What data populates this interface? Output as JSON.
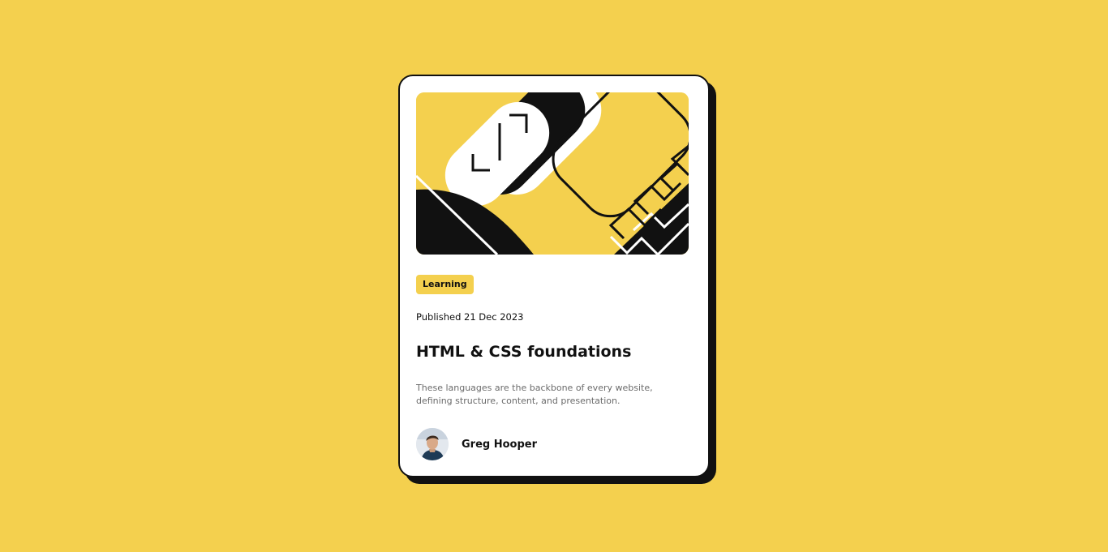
{
  "card": {
    "tag": "Learning",
    "published": "Published 21 Dec 2023",
    "title": "HTML & CSS foundations",
    "excerpt": "These languages are the backbone of every website, defining structure, content, and presentation.",
    "author": {
      "name": "Greg Hooper",
      "avatar_icon": "avatar-photo"
    },
    "illustration_icon": "abstract-geometric-illustration"
  },
  "colors": {
    "background": "#F4D04E",
    "card": "#FFFFFF",
    "ink": "#111111",
    "muted_text": "#6B6B6B",
    "badge": "#F4D04E"
  }
}
